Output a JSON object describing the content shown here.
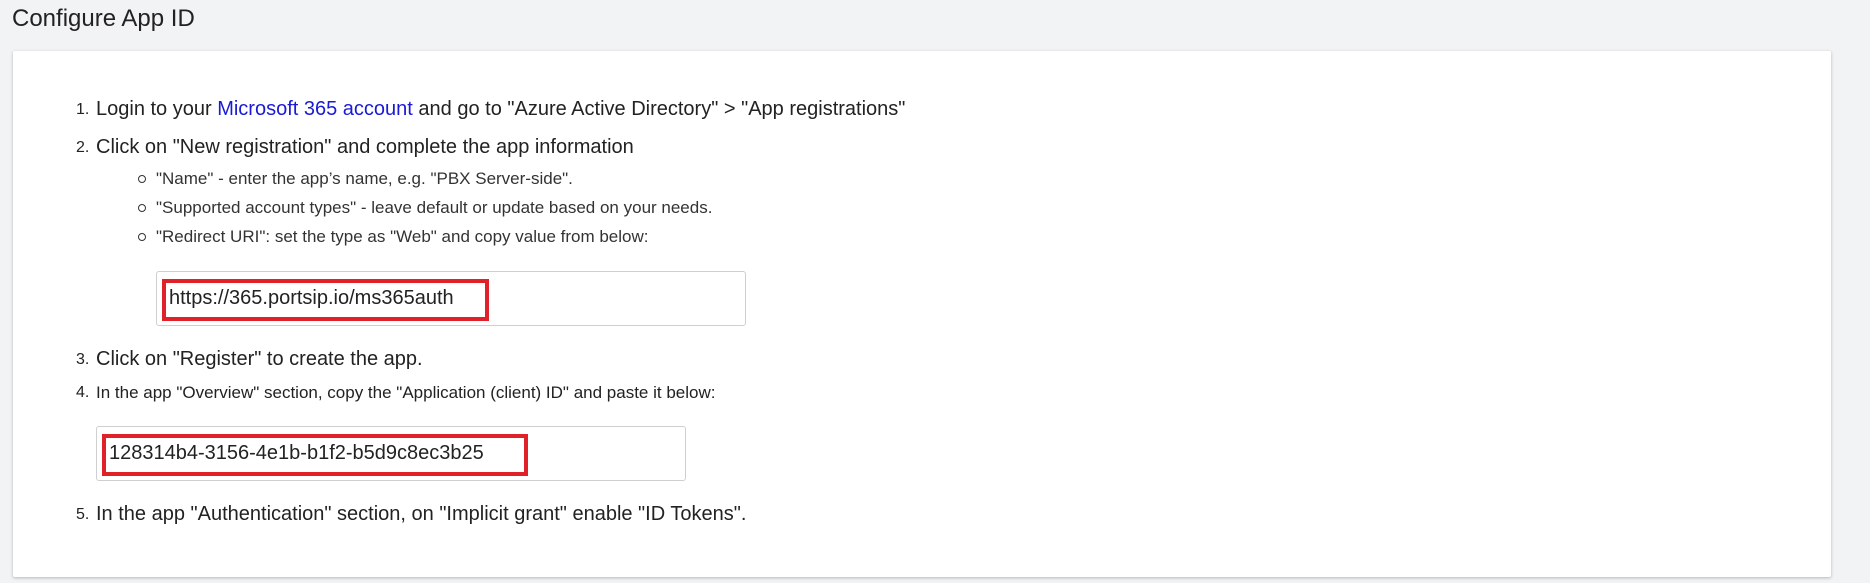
{
  "page": {
    "title": "Configure App ID"
  },
  "steps": [
    {
      "num": "1.",
      "prefix": "Login to your ",
      "link": "Microsoft 365 account",
      "suffix": " and go to \"Azure Active Directory\" > \"App registrations\""
    },
    {
      "num": "2.",
      "text": "Click on \"New registration\" and complete the app information",
      "subitems": [
        "\"Name\" - enter the app’s name, e.g. \"PBX Server-side\".",
        "\"Supported account types\" - leave default or update based on your needs.",
        "\"Redirect URI\": set the type as \"Web\" and copy value from below:"
      ]
    },
    {
      "num": "3.",
      "text": "Click on \"Register\" to create the app."
    },
    {
      "num": "4.",
      "text": "In the app \"Overview\" section, copy the \"Application (client) ID\" and paste it below:"
    },
    {
      "num": "5.",
      "text": "In the app \"Authentication\" section, on \"Implicit grant\" enable \"ID Tokens\"."
    }
  ],
  "redirect_uri_field": {
    "value": "https://365.portsip.io/ms365auth"
  },
  "client_id_field": {
    "value": "128314b4-3156-4e1b-b1f2-b5d9c8ec3b25"
  },
  "colors": {
    "link": "#1a1ad6",
    "highlight": "#e0212a",
    "background": "#f2f3f5"
  }
}
